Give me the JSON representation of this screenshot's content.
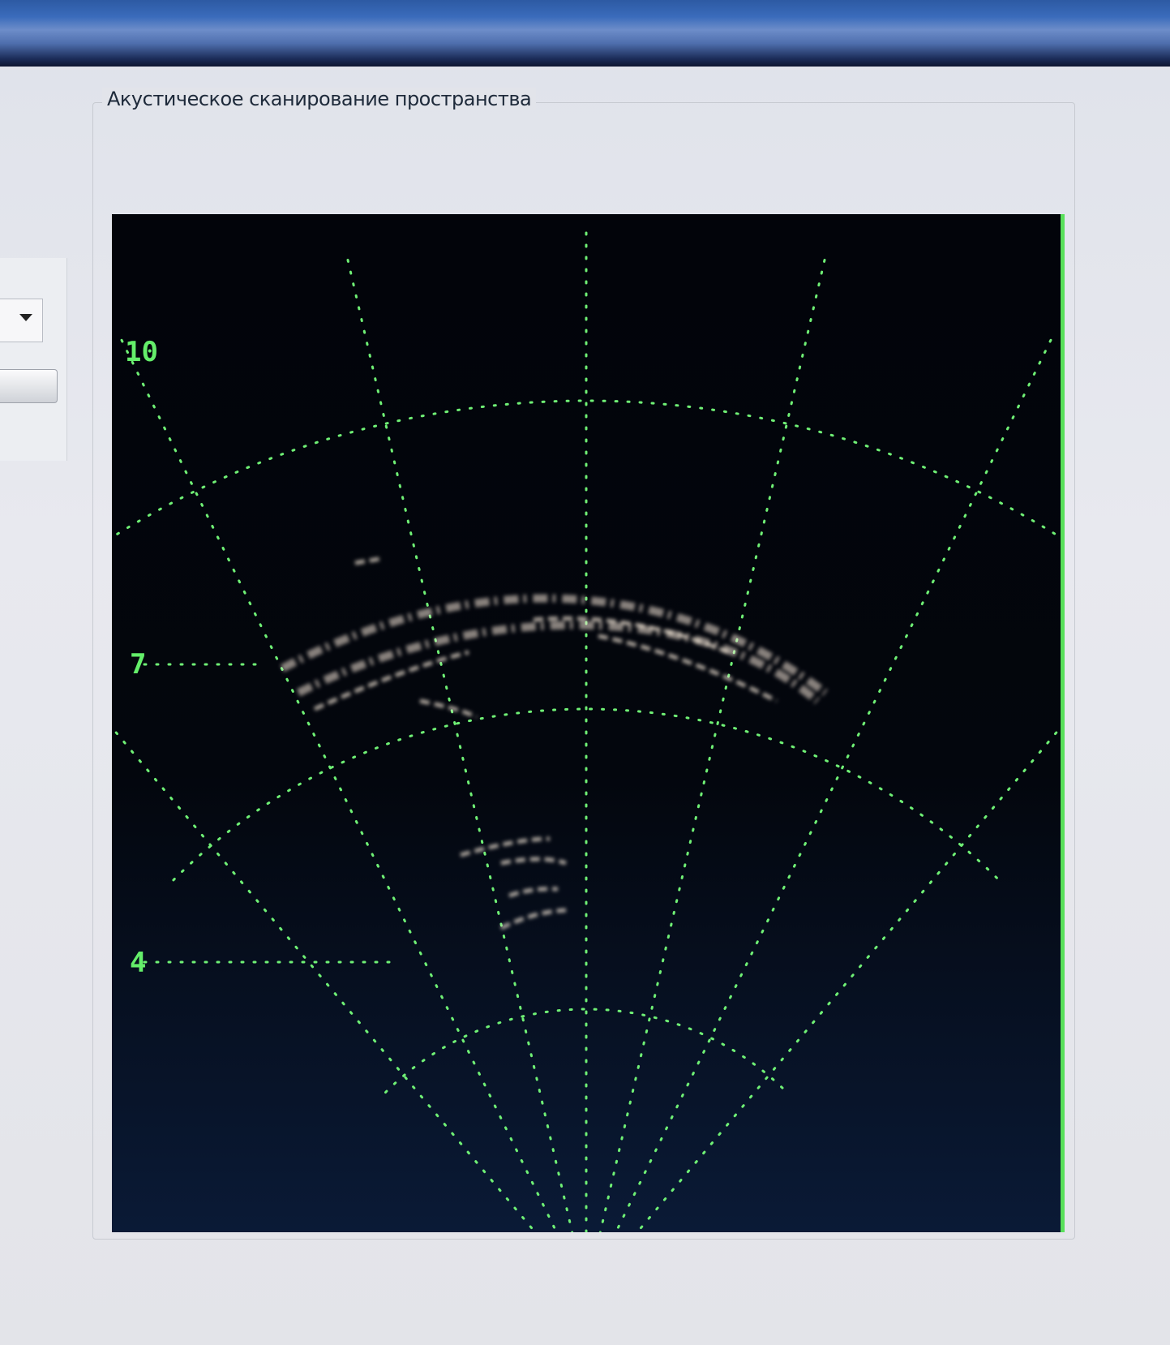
{
  "window": {
    "panel_title": "Акустическое сканирование пространства"
  },
  "scan": {
    "range_labels": [
      "10",
      "7",
      "4"
    ],
    "grid_color": "#6ff075",
    "echo_color": "#f5e8d8"
  },
  "icons": {
    "dropdown": "chevron-down-icon"
  }
}
